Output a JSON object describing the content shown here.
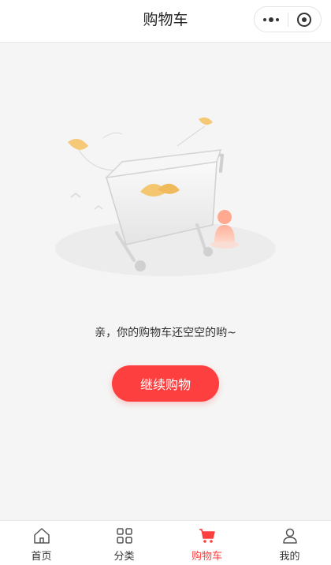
{
  "header": {
    "title": "购物车"
  },
  "empty_state": {
    "message": "亲，你的购物车还空空的哟~",
    "button_label": "继续购物"
  },
  "tabbar": {
    "active_color": "#fe3f3f",
    "items": [
      {
        "label": "首页",
        "icon": "home-icon"
      },
      {
        "label": "分类",
        "icon": "category-grid-icon"
      },
      {
        "label": "购物车",
        "icon": "cart-icon",
        "active": true
      },
      {
        "label": "我的",
        "icon": "profile-icon"
      }
    ]
  }
}
